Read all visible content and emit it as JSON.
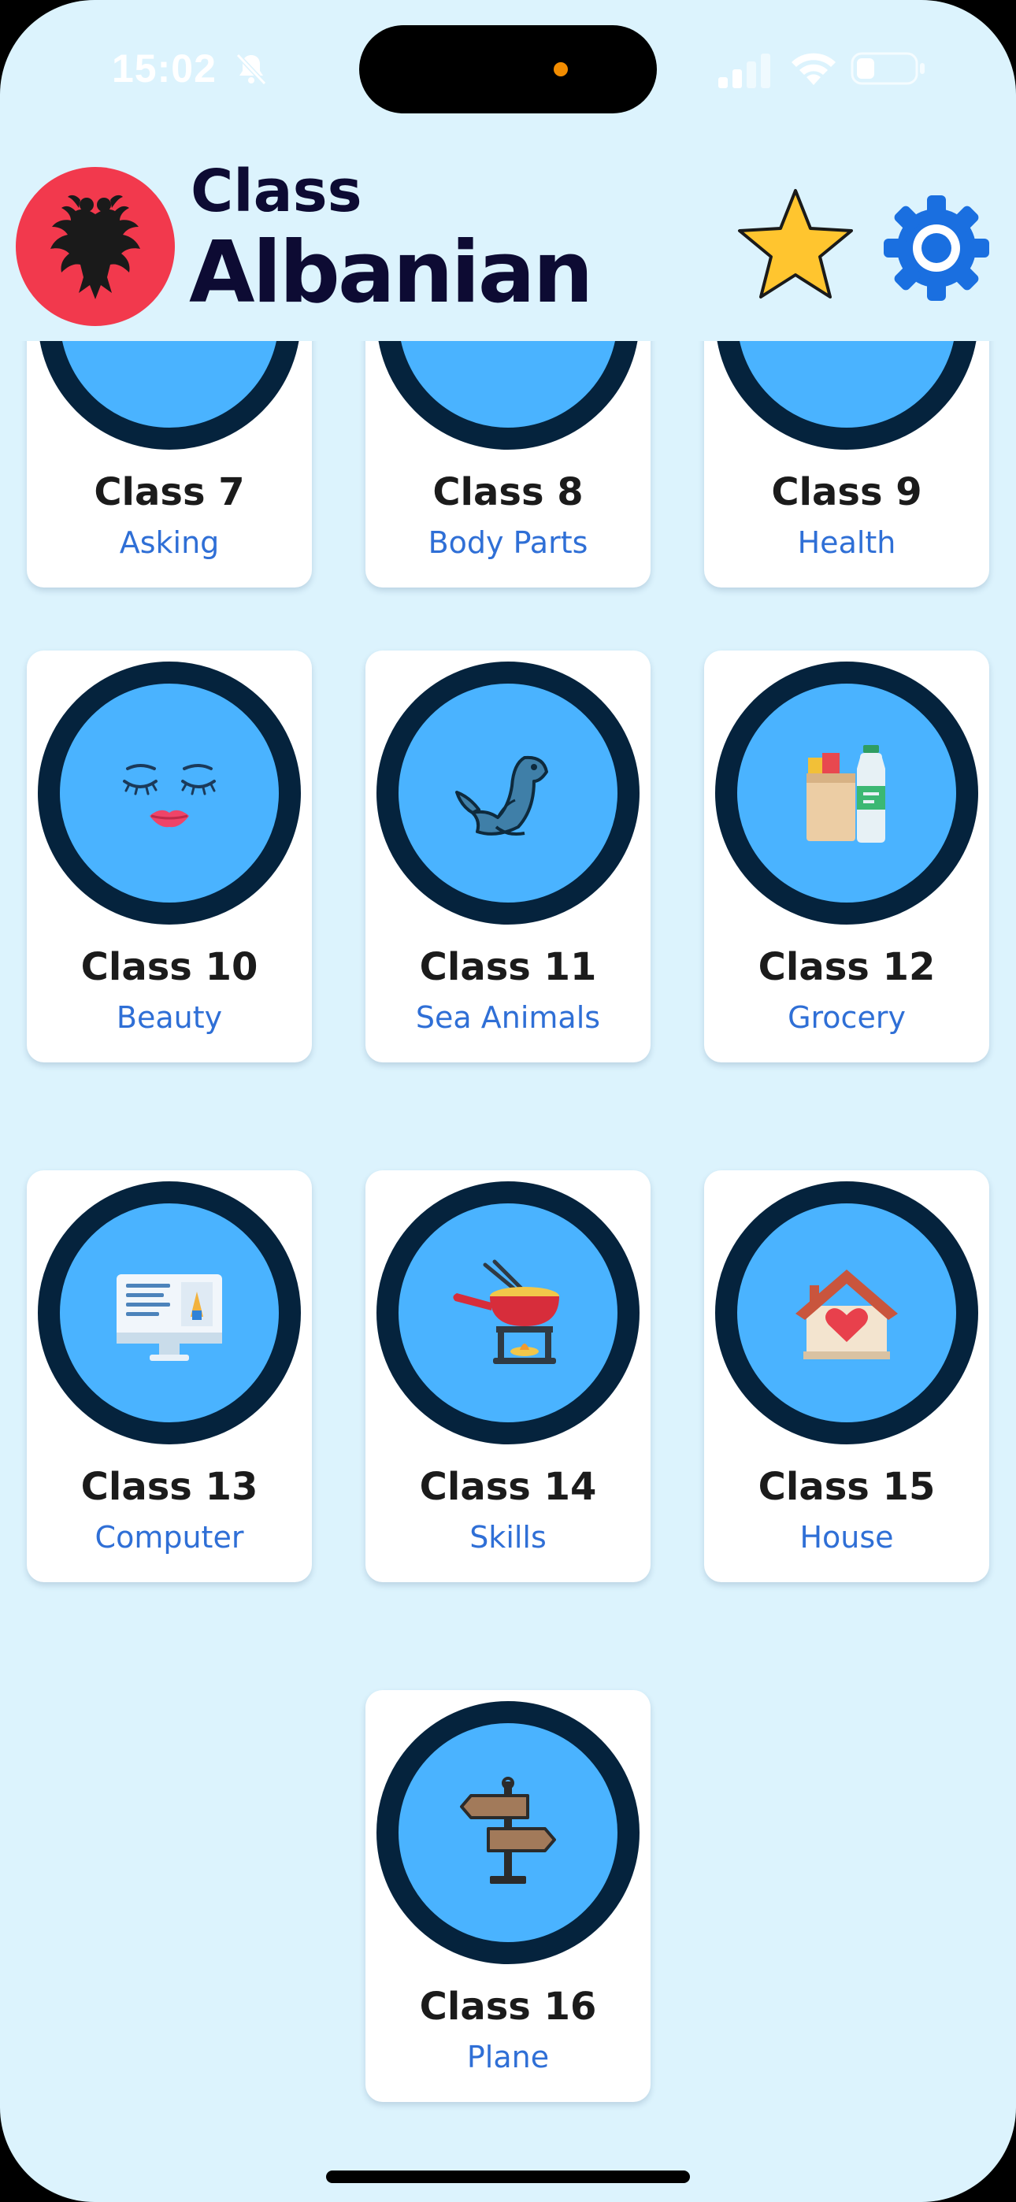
{
  "status_bar": {
    "time": "15:02",
    "icons": [
      "bell-slash-icon",
      "signal-icon",
      "wifi-icon",
      "battery-icon"
    ]
  },
  "header": {
    "title_top": "Class",
    "title_main": "Albanian",
    "flag_icon": "albania-flag-icon",
    "favorites_icon": "star-icon",
    "settings_icon": "gear-icon"
  },
  "colors": {
    "background": "#dcf3fd",
    "card": "#ffffff",
    "ring_outer": "#05233d",
    "ring_inner": "#4ab3ff",
    "title": "#1b1b1b",
    "subtitle": "#2f6fd6",
    "flag_red": "#f2394d",
    "star": "#ffc52f",
    "gear": "#1a6fe0"
  },
  "classes": [
    {
      "title": "Class 7",
      "subtitle": "Asking",
      "icon": "question-icon"
    },
    {
      "title": "Class 8",
      "subtitle": "Body Parts",
      "icon": "body-icon"
    },
    {
      "title": "Class 9",
      "subtitle": "Health",
      "icon": "health-icon"
    },
    {
      "title": "Class 10",
      "subtitle": "Beauty",
      "icon": "face-makeup-icon"
    },
    {
      "title": "Class 11",
      "subtitle": "Sea Animals",
      "icon": "seal-icon"
    },
    {
      "title": "Class 12",
      "subtitle": "Grocery",
      "icon": "grocery-bag-icon"
    },
    {
      "title": "Class 13",
      "subtitle": "Computer",
      "icon": "computer-monitor-icon"
    },
    {
      "title": "Class 14",
      "subtitle": "Skills",
      "icon": "fondue-pot-icon"
    },
    {
      "title": "Class 15",
      "subtitle": "House",
      "icon": "house-heart-icon"
    },
    {
      "title": "Class 16",
      "subtitle": "Plane",
      "icon": "signpost-icon"
    }
  ]
}
